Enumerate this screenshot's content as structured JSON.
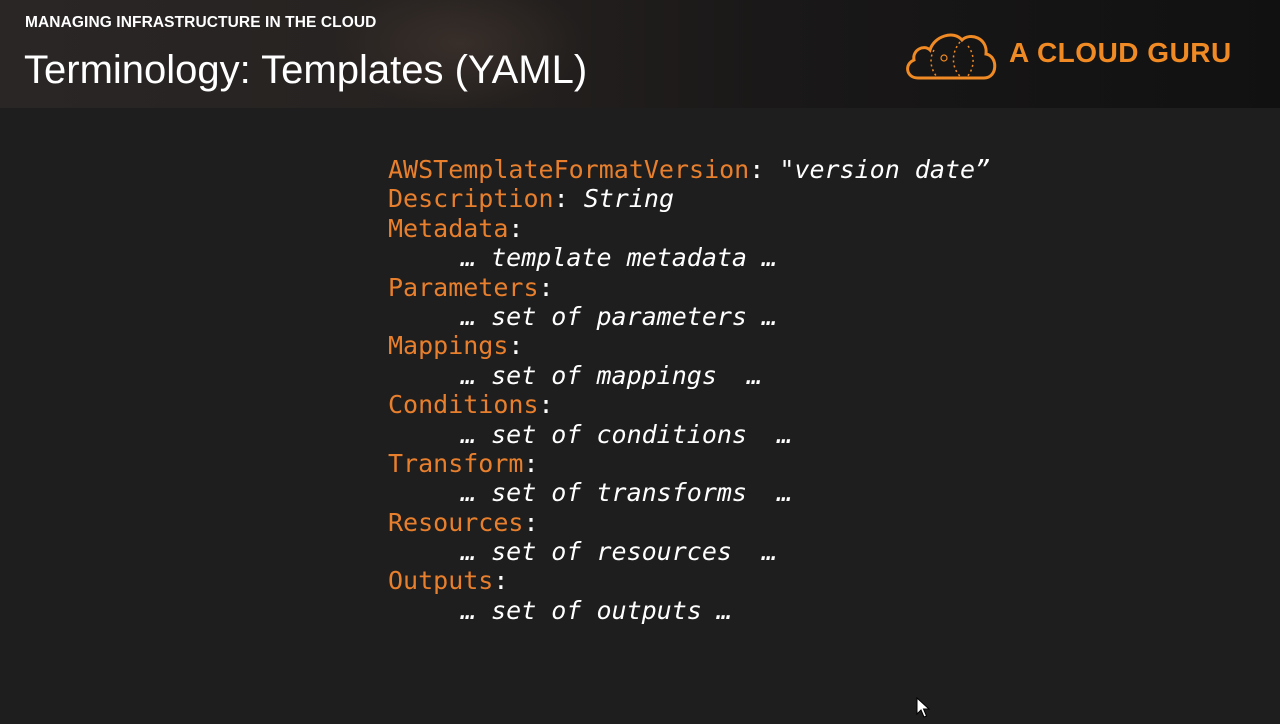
{
  "header": {
    "subtitle": "MANAGING INFRASTRUCTURE IN THE CLOUD",
    "title": "Terminology: Templates (YAML)",
    "logo_text": "A CLOUD GURU",
    "brand_color": "#f08a24"
  },
  "code": {
    "lines": [
      {
        "key": "AWSTemplateFormatVersion",
        "sep": ": ",
        "value": "\"version date”"
      },
      {
        "key": "Description",
        "sep": ": ",
        "value": "String"
      },
      {
        "key": "Metadata",
        "sep": ":"
      },
      {
        "text": "… template metadata …"
      },
      {
        "key": "Parameters",
        "sep": ":"
      },
      {
        "text": "… set of parameters …"
      },
      {
        "key": "Mappings",
        "sep": ":"
      },
      {
        "text": "… set of mappings  …"
      },
      {
        "key": "Conditions",
        "sep": ":"
      },
      {
        "text": "… set of conditions  …"
      },
      {
        "key": "Transform",
        "sep": ":"
      },
      {
        "text": "… set of transforms  …"
      },
      {
        "key": "Resources",
        "sep": ":"
      },
      {
        "text": "… set of resources  …"
      },
      {
        "key": "Outputs",
        "sep": ":"
      },
      {
        "text": "… set of outputs …"
      }
    ],
    "key_color": "#e87f2d"
  },
  "icons": {
    "logo": "cloud-logo-icon",
    "cursor": "mouse-pointer-icon"
  }
}
